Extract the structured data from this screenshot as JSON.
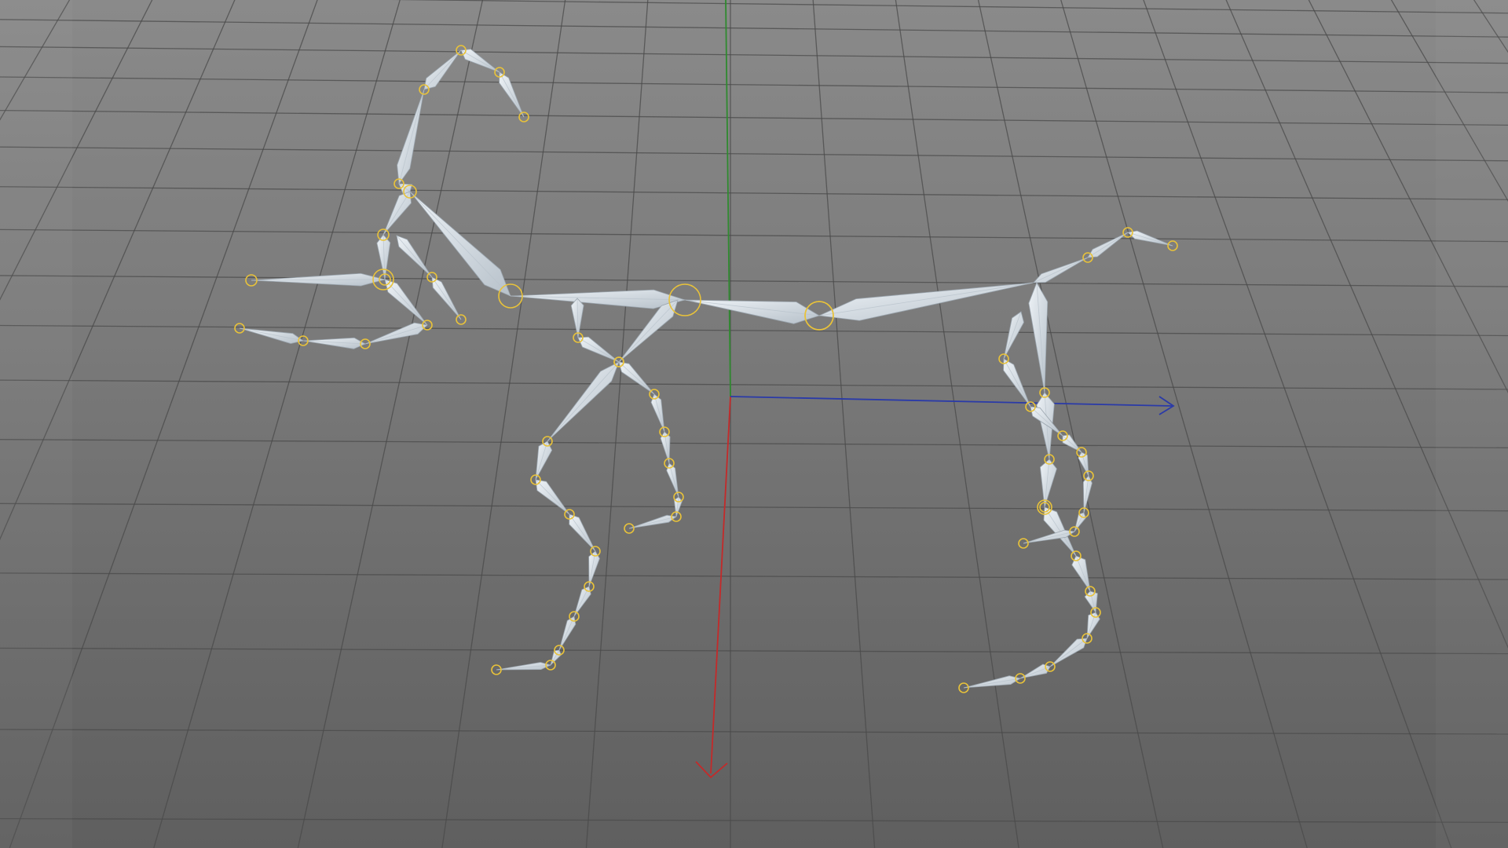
{
  "viewport": {
    "background_top": "#8a8a8a",
    "background_bottom": "#5f5f5f"
  },
  "colors": {
    "grid_line": "#4a4a4a",
    "axis_x": "#2a3aa8",
    "axis_y": "#2f8a2f",
    "axis_z": "#c42a2a",
    "bone_fill": "#dfe6ec",
    "bone_shade": "#b9c3cc",
    "bone_stroke": "#9aa4ad",
    "joint": "#e8c23a"
  },
  "icons": {
    "axis_x_arrow": "arrow-right-icon",
    "axis_z_arrow": "arrow-down-icon",
    "joint": "joint-circle-icon"
  }
}
